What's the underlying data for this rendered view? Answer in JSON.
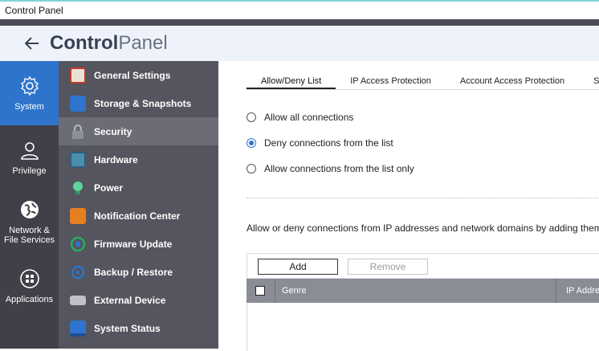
{
  "window": {
    "title": "Control Panel"
  },
  "header": {
    "title_bold": "Control",
    "title_light": "Panel",
    "back_icon": "arrow-left-icon"
  },
  "leftnav": {
    "items": [
      {
        "label": "System",
        "icon": "gear-icon",
        "active": true
      },
      {
        "label": "Privilege",
        "icon": "user-icon",
        "active": false
      },
      {
        "label": "Network &\nFile Services",
        "icon": "globe-icon",
        "active": false
      },
      {
        "label": "Applications",
        "icon": "apps-grid-icon",
        "active": false
      }
    ]
  },
  "subnav": {
    "items": [
      {
        "label": "General Settings",
        "icon": "general-settings-icon",
        "color": "#c0392b"
      },
      {
        "label": "Storage & Snapshots",
        "icon": "storage-icon",
        "color": "#2f74cc"
      },
      {
        "label": "Security",
        "icon": "lock-icon",
        "color": "#9a9ca2"
      },
      {
        "label": "Hardware",
        "icon": "hardware-icon",
        "color": "#4a8db0"
      },
      {
        "label": "Power",
        "icon": "power-bulb-icon",
        "color": "#3cb371"
      },
      {
        "label": "Notification Center",
        "icon": "notification-icon",
        "color": "#e67e22"
      },
      {
        "label": "Firmware Update",
        "icon": "firmware-icon",
        "color": "#27ae60"
      },
      {
        "label": "Backup / Restore",
        "icon": "backup-icon",
        "color": "#2f74cc"
      },
      {
        "label": "External Device",
        "icon": "external-device-icon",
        "color": "#bfc1c6"
      },
      {
        "label": "System Status",
        "icon": "system-status-icon",
        "color": "#2f74cc"
      }
    ]
  },
  "tabs": [
    "Allow/Deny List",
    "IP Access Protection",
    "Account Access Protection",
    "S"
  ],
  "radios": [
    {
      "label": "Allow all connections",
      "checked": false
    },
    {
      "label": "Deny connections from the list",
      "checked": true
    },
    {
      "label": "Allow connections from the list only",
      "checked": false
    }
  ],
  "description": "Allow or deny connections from IP addresses and network domains by adding them",
  "toolbar": {
    "add_label": "Add",
    "remove_label": "Remove"
  },
  "table": {
    "columns": [
      "Genre",
      "IP Addre"
    ]
  },
  "colors": {
    "accent": "#2f74cc",
    "sidebar": "#3f4048",
    "subnav": "#54555e"
  }
}
